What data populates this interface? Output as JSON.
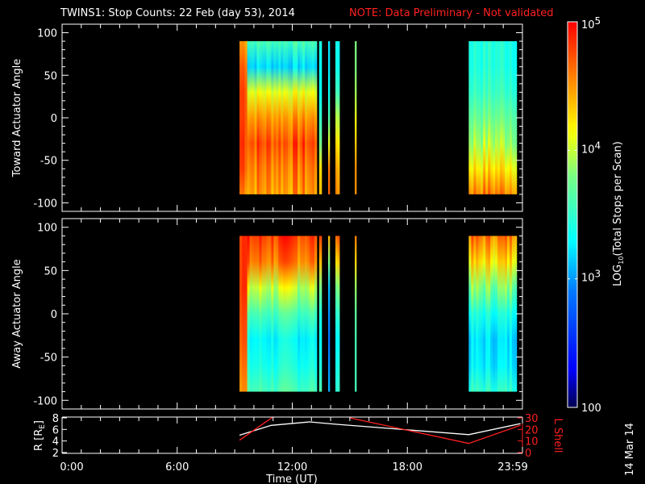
{
  "title": {
    "main": "TWINS1: Stop Counts: 22 Feb (day  53), 2014",
    "note": "NOTE: Data Preliminary - Not validated"
  },
  "side_date": "14 Mar 14",
  "colors": {
    "text": "#ffffff",
    "note": "#ff2020",
    "background": "#000000",
    "lshell": "#ff2020",
    "r_line": "#ffffff"
  },
  "chart_data": [
    {
      "type": "heatmap",
      "id": "toward",
      "ylabel": "Toward Actuator Angle",
      "ylim": [
        -110,
        110
      ],
      "yticks": [
        100,
        50,
        0,
        -50,
        -100
      ],
      "xlim_hours": [
        0,
        24
      ],
      "angles": [
        -90,
        -60,
        -30,
        0,
        30,
        60,
        90
      ],
      "segments": [
        {
          "t0": 9.25,
          "t1": 9.65,
          "log_counts": [
            4.6,
            4.8,
            4.85,
            4.8,
            4.8,
            4.7,
            4.5
          ]
        },
        {
          "t0": 9.65,
          "t1": 13.28,
          "log_counts": [
            4.5,
            4.6,
            4.75,
            4.5,
            4.1,
            3.2,
            3.6
          ]
        },
        {
          "t0": 13.4,
          "t1": 13.53,
          "log_counts": [
            4.5,
            4.4,
            3.9,
            3.6,
            3.4,
            3.4,
            3.5
          ]
        },
        {
          "t0": 13.87,
          "t1": 13.95,
          "log_counts": [
            4.5,
            4.4,
            3.9,
            3.5,
            3.2,
            3.1,
            3.1
          ]
        },
        {
          "t0": 14.25,
          "t1": 14.46,
          "log_counts": [
            4.6,
            4.5,
            4.3,
            4.0,
            3.6,
            3.4,
            3.4
          ]
        },
        {
          "t0": 15.26,
          "t1": 15.34,
          "log_counts": [
            4.5,
            4.5,
            4.3,
            4.1,
            3.9,
            3.8,
            3.8
          ]
        },
        {
          "t0": 21.2,
          "t1": 23.7,
          "log_counts": [
            4.6,
            4.25,
            3.95,
            3.75,
            3.55,
            3.45,
            3.45
          ]
        }
      ]
    },
    {
      "type": "heatmap",
      "id": "away",
      "ylabel": "Away Actuator Angle",
      "ylim": [
        -110,
        110
      ],
      "yticks": [
        100,
        50,
        0,
        -50,
        -100
      ],
      "xlim_hours": [
        0,
        24
      ],
      "angles": [
        -90,
        -60,
        -30,
        0,
        30,
        60,
        90
      ],
      "segments": [
        {
          "t0": 9.25,
          "t1": 9.65,
          "log_counts": [
            4.5,
            4.6,
            4.7,
            4.75,
            4.8,
            4.8,
            4.8
          ]
        },
        {
          "t0": 9.65,
          "t1": 13.28,
          "log_counts": [
            3.6,
            3.4,
            3.3,
            3.6,
            4.0,
            4.6,
            4.8
          ]
        },
        {
          "t0": 13.4,
          "t1": 13.53,
          "log_counts": [
            3.5,
            3.3,
            3.2,
            3.3,
            3.6,
            4.2,
            4.6
          ]
        },
        {
          "t0": 13.87,
          "t1": 13.95,
          "log_counts": [
            3.2,
            3.1,
            3.0,
            3.1,
            3.3,
            4.0,
            4.6
          ]
        },
        {
          "t0": 14.25,
          "t1": 14.46,
          "log_counts": [
            3.5,
            3.4,
            3.3,
            3.5,
            3.8,
            4.3,
            4.7
          ]
        },
        {
          "t0": 15.26,
          "t1": 15.34,
          "log_counts": [
            3.6,
            3.6,
            3.6,
            3.7,
            3.9,
            4.3,
            4.6
          ]
        },
        {
          "t0": 21.2,
          "t1": 23.7,
          "log_counts": [
            3.5,
            3.25,
            3.2,
            3.4,
            3.8,
            4.25,
            4.6
          ]
        }
      ]
    },
    {
      "type": "line",
      "id": "position",
      "ylabel": "R [R",
      "ylabel_sub": "E",
      "ylabel_close": "]",
      "ylim": [
        2,
        8
      ],
      "yticks": [
        8,
        6,
        4,
        2
      ],
      "y2label": "L Shell",
      "y2lim": [
        0,
        30
      ],
      "y2ticks": [
        30,
        20,
        10,
        0
      ],
      "xlabel": "Time (UT)",
      "xticks": [
        {
          "h": 0,
          "label": "0:00"
        },
        {
          "h": 6,
          "label": "6:00"
        },
        {
          "h": 12,
          "label": "12:00"
        },
        {
          "h": 18,
          "label": "18:00"
        },
        {
          "h": 24,
          "label": "23:59"
        }
      ],
      "series": [
        {
          "name": "R",
          "axis": "left",
          "x": [
            9.25,
            10.9,
            12.9,
            14.25,
            21.2,
            23.9
          ],
          "y": [
            5.0,
            6.7,
            7.3,
            6.9,
            5.1,
            7.0
          ]
        },
        {
          "name": "L Shell",
          "axis": "right",
          "x": [
            9.25,
            11.1
          ],
          "y": [
            10.7,
            32
          ]
        },
        {
          "name": "L Shell",
          "axis": "right",
          "x": [
            15.0,
            21.2,
            23.9
          ],
          "y": [
            30,
            7.9,
            23.6
          ]
        }
      ]
    },
    {
      "type": "colorbar",
      "label_main": "LOG",
      "label_sub": "10",
      "label_rest": "(Total Stops per Scan)",
      "range_log": [
        2,
        5
      ],
      "ticks": [
        {
          "v": 5,
          "base": "10",
          "exp": "5"
        },
        {
          "v": 4,
          "base": "10",
          "exp": "4"
        },
        {
          "v": 3,
          "base": "10",
          "exp": "3"
        },
        {
          "v": 2,
          "base": "100",
          "exp": ""
        }
      ]
    }
  ]
}
